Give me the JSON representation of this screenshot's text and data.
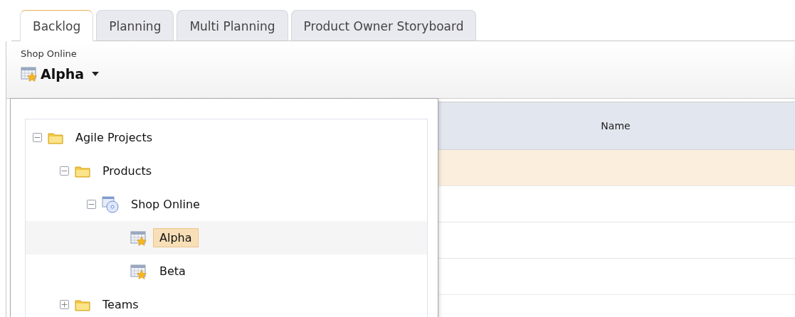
{
  "tabs": [
    {
      "label": "Backlog",
      "selected": true
    },
    {
      "label": "Planning",
      "selected": false
    },
    {
      "label": "Multi Planning",
      "selected": false
    },
    {
      "label": "Product Owner Storyboard",
      "selected": false
    }
  ],
  "breadcrumb": "Shop Online",
  "selector": {
    "label": "Alpha",
    "kind": "release"
  },
  "tree": [
    {
      "label": "Agile Projects",
      "kind": "folder",
      "expanded": true,
      "selected": false,
      "children": [
        {
          "label": "Products",
          "kind": "folder",
          "expanded": true,
          "selected": false,
          "children": [
            {
              "label": "Shop Online",
              "kind": "product",
              "expanded": true,
              "selected": false,
              "children": [
                {
                  "label": "Alpha",
                  "kind": "release",
                  "selected": true
                },
                {
                  "label": "Beta",
                  "kind": "release",
                  "selected": false
                }
              ]
            }
          ]
        },
        {
          "label": "Teams",
          "kind": "folder",
          "expanded": false,
          "selected": false
        }
      ]
    }
  ],
  "table": {
    "columns": [
      "Name"
    ],
    "rows": [
      {
        "selected": true
      },
      {
        "selected": false
      },
      {
        "selected": false
      },
      {
        "selected": false
      }
    ]
  }
}
